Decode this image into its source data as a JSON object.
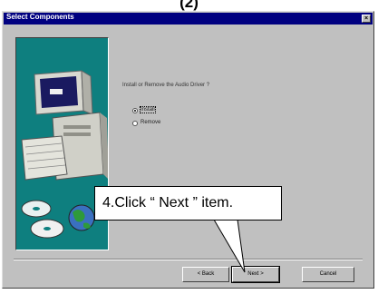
{
  "page_number": "(2)",
  "window": {
    "title": "Select Components",
    "close_label": "×"
  },
  "content": {
    "prompt": "Install or Remove the Audio Driver ?",
    "options": [
      {
        "label": "Install",
        "selected": true
      },
      {
        "label": "Remove",
        "selected": false
      }
    ]
  },
  "buttons": {
    "back": "< Back",
    "next": "Next >",
    "cancel": "Cancel"
  },
  "callout": {
    "text": "4.Click “ Next ” item."
  }
}
